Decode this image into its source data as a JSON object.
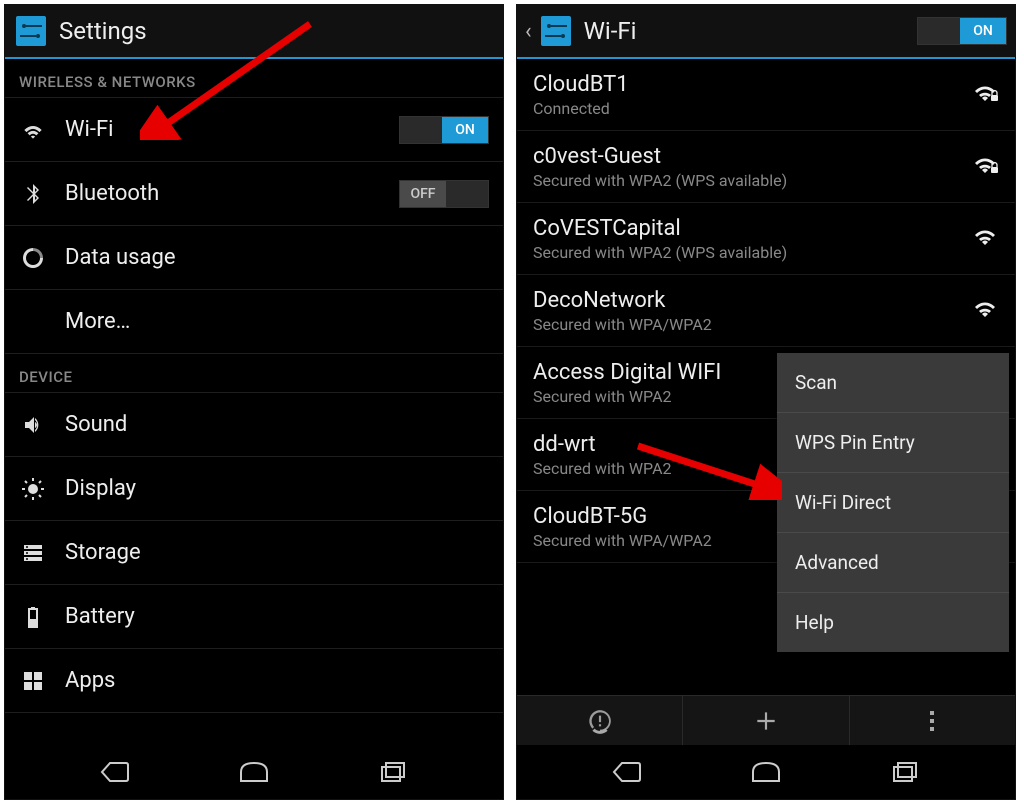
{
  "left": {
    "title": "Settings",
    "sections": {
      "wireless_header": "WIRELESS & NETWORKS",
      "device_header": "DEVICE"
    },
    "wifi_label": "Wi-Fi",
    "wifi_toggle": "ON",
    "bluetooth_label": "Bluetooth",
    "bluetooth_toggle": "OFF",
    "data_usage_label": "Data usage",
    "more_label": "More…",
    "sound_label": "Sound",
    "display_label": "Display",
    "storage_label": "Storage",
    "battery_label": "Battery",
    "apps_label": "Apps"
  },
  "right": {
    "title": "Wi-Fi",
    "toggle": "ON",
    "networks": [
      {
        "ssid": "CloudBT1",
        "sub": "Connected",
        "locked": true
      },
      {
        "ssid": "c0vest-Guest",
        "sub": "Secured with WPA2 (WPS available)",
        "locked": true
      },
      {
        "ssid": "CoVESTCapital",
        "sub": "Secured with WPA2 (WPS available)",
        "locked": false
      },
      {
        "ssid": "DecoNetwork",
        "sub": "Secured with WPA/WPA2",
        "locked": false
      },
      {
        "ssid": "Access Digital WIFI",
        "sub": "Secured with WPA2",
        "locked": false
      },
      {
        "ssid": "dd-wrt",
        "sub": "Secured with WPA2",
        "locked": false
      },
      {
        "ssid": "CloudBT-5G",
        "sub": "Secured with WPA/WPA2",
        "locked": false
      }
    ],
    "menu": {
      "scan": "Scan",
      "wps": "WPS Pin Entry",
      "direct": "Wi-Fi Direct",
      "advanced": "Advanced",
      "help": "Help"
    }
  }
}
